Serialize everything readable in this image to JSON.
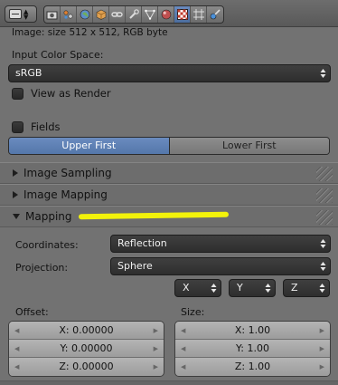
{
  "header": {
    "tabs": [
      "render-icon",
      "scene-icon",
      "world-icon",
      "object-icon",
      "constraint-icon",
      "modifier-icon",
      "data-icon",
      "material-icon",
      "texture-icon",
      "particles-icon",
      "physics-icon"
    ],
    "active_tab_color": "#5a7cb0"
  },
  "image_info": "Image: size 512 x 512, RGB byte",
  "color_space": {
    "label": "Input Color Space:",
    "value": "sRGB"
  },
  "view_as_render": {
    "label": "View as Render",
    "checked": false
  },
  "fields": {
    "label": "Fields",
    "checked": false
  },
  "field_order": {
    "options": [
      "Upper First",
      "Lower First"
    ],
    "selected": "Upper First"
  },
  "panels": {
    "image_sampling": {
      "label": "Image Sampling",
      "expanded": false
    },
    "image_mapping": {
      "label": "Image Mapping",
      "expanded": false
    },
    "mapping": {
      "label": "Mapping",
      "expanded": true
    }
  },
  "mapping": {
    "coordinates_label": "Coordinates:",
    "coordinates_value": "Reflection",
    "projection_label": "Projection:",
    "projection_value": "Sphere",
    "axes": [
      "X",
      "Y",
      "Z"
    ],
    "offset": {
      "label": "Offset:",
      "x": "X: 0.00000",
      "y": "Y: 0.00000",
      "z": "Z: 0.00000"
    },
    "size": {
      "label": "Size:",
      "x": "X: 1.00",
      "y": "Y: 1.00",
      "z": "Z: 1.00"
    }
  },
  "annotation_color": "#f2f20a"
}
